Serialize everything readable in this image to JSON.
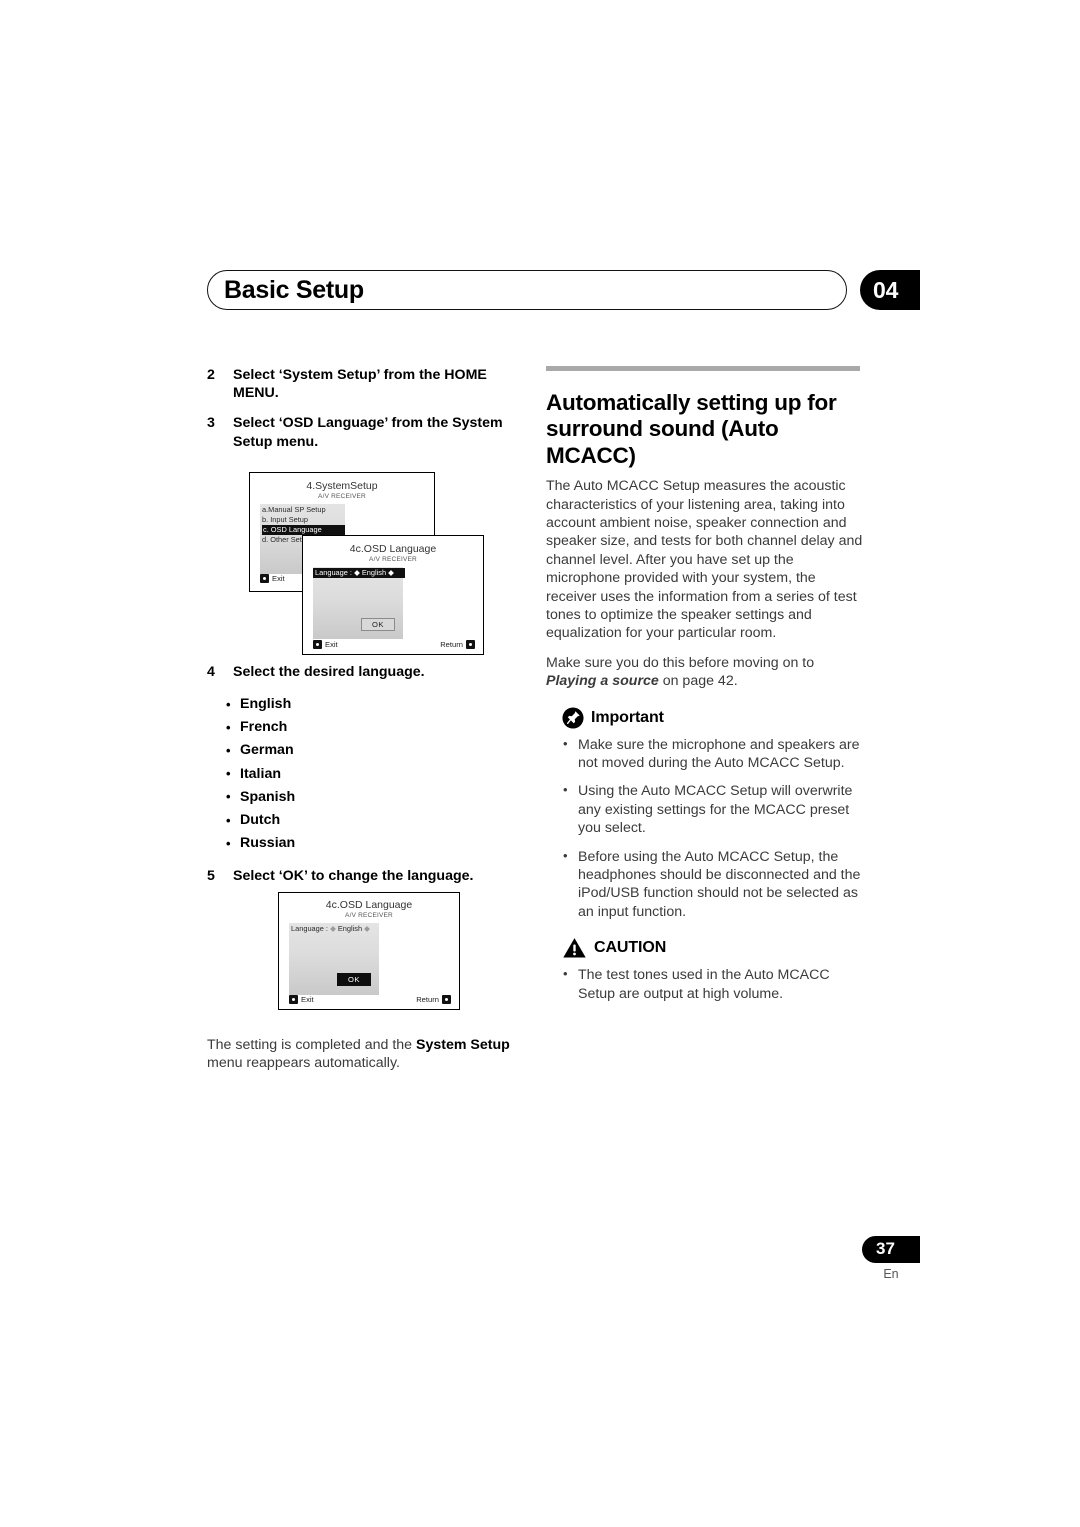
{
  "header": {
    "title": "Basic Setup",
    "chapter": "04"
  },
  "left": {
    "step2": {
      "num": "2",
      "text": "Select ‘System Setup’ from the HOME MENU."
    },
    "step3": {
      "num": "3",
      "text": "Select ‘OSD Language’ from the System Setup menu."
    },
    "step4": {
      "num": "4",
      "text": "Select the desired language."
    },
    "languages": [
      "English",
      "French",
      "German",
      "Italian",
      "Spanish",
      "Dutch",
      "Russian"
    ],
    "step5": {
      "num": "5",
      "text": "Select ‘OK’ to change the language."
    },
    "closing_pre": "The setting is completed and the ",
    "closing_bold": "System Setup",
    "closing_post": " menu reappears automatically."
  },
  "osd": {
    "system_setup": {
      "title": "4.SystemSetup",
      "subtitle": "A/V RECEIVER",
      "items": [
        {
          "label": "a.Manual SP Setup",
          "selected": false
        },
        {
          "label": "b. Input Setup",
          "selected": false
        },
        {
          "label": "c. OSD Language",
          "selected": true
        },
        {
          "label": "d. Other Setup",
          "selected": false
        }
      ],
      "exit_label": "Exit"
    },
    "osd_language_1": {
      "title": "4c.OSD Language",
      "subtitle": "A/V RECEIVER",
      "row_label": "Language  :",
      "row_value": "English",
      "row_selected": true,
      "ok_label": "OK",
      "ok_selected": false,
      "exit_label": "Exit",
      "return_label": "Return"
    },
    "osd_language_2": {
      "title": "4c.OSD Language",
      "subtitle": "A/V RECEIVER",
      "row_label": "Language  :",
      "row_value": "English",
      "row_selected": false,
      "ok_label": "OK",
      "ok_selected": true,
      "exit_label": "Exit",
      "return_label": "Return"
    }
  },
  "right": {
    "section_title": "Automatically setting up for surround sound (Auto MCACC)",
    "paragraph1": "The Auto MCACC Setup measures the acoustic characteristics of your listening area, taking into account ambient noise, speaker connection and speaker size, and tests for both channel delay and channel level. After you have set up the microphone provided with your system, the receiver uses the information from a series of test tones to optimize the speaker settings and equalization for your particular room.",
    "paragraph2_pre": "Make sure you do this before moving on to ",
    "paragraph2_italic": "Playing a source",
    "paragraph2_post": " on page 42.",
    "important": {
      "label": "Important",
      "icon": "pushpin-icon",
      "bullets": [
        "Make sure the microphone and speakers are not moved during the Auto MCACC Setup.",
        "Using the Auto MCACC Setup will overwrite any existing settings for the MCACC preset you select.",
        "Before using the Auto MCACC Setup, the headphones should be disconnected and the iPod/USB function should not be selected as an input function."
      ]
    },
    "caution": {
      "label": "CAUTION",
      "icon": "warning-triangle-icon",
      "bullets": [
        "The test tones used in the Auto MCACC Setup are output at high volume."
      ]
    }
  },
  "footer": {
    "page_number": "37",
    "language_code": "En"
  }
}
